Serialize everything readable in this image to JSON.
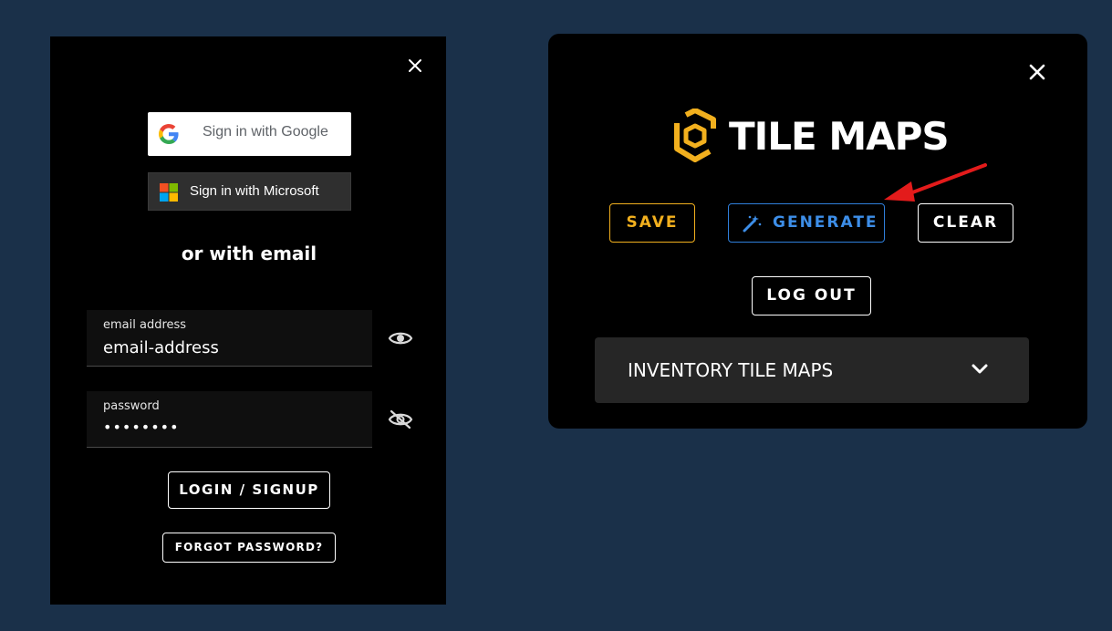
{
  "login": {
    "google_label": "Sign in with Google",
    "microsoft_label": "Sign in with Microsoft",
    "divider_text": "or with email",
    "email": {
      "label": "email address",
      "value": "email-address"
    },
    "password": {
      "label": "password",
      "value": "••••••••"
    },
    "login_label": "LOGIN / SIGNUP",
    "forgot_label": "FORGOT PASSWORD?",
    "icons": [
      "close-icon",
      "google-icon",
      "microsoft-icon",
      "eye-icon",
      "eye-off-icon"
    ]
  },
  "tilemaps": {
    "title": "TILE MAPS",
    "buttons": {
      "save": "SAVE",
      "generate": "GENERATE",
      "clear": "CLEAR",
      "logout": "LOG OUT"
    },
    "inventory_label": "INVENTORY TILE MAPS",
    "icons": [
      "close-icon",
      "logo-icon",
      "magic-wand-icon",
      "chevron-down-icon",
      "red-arrow-annotation"
    ]
  },
  "colors": {
    "background": "#1a3049",
    "panel": "#000000",
    "accent_gold": "#f2b01e",
    "accent_blue": "#3d8ee8",
    "annotation_red": "#e31b1b"
  }
}
